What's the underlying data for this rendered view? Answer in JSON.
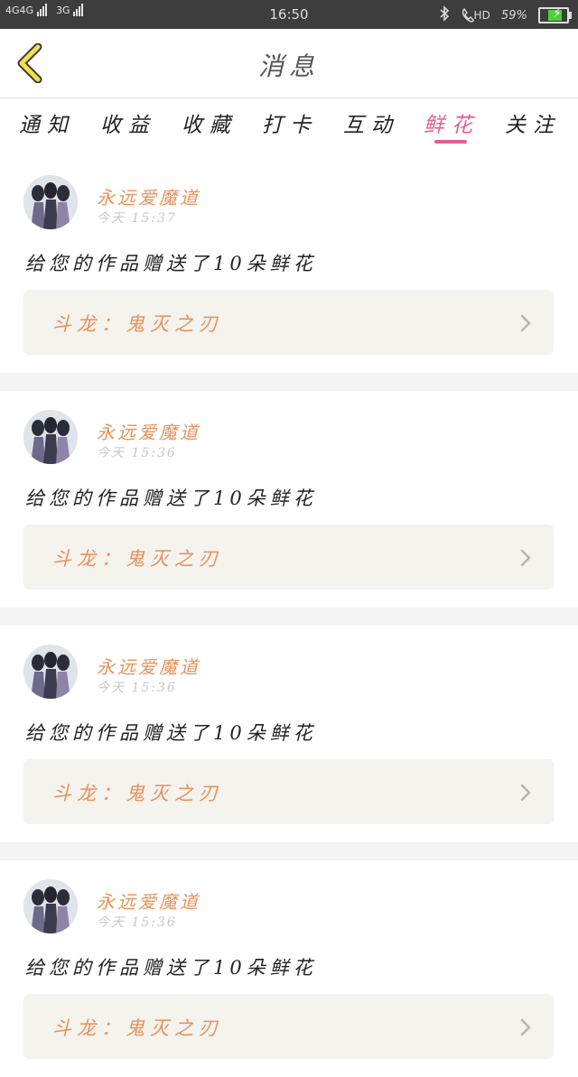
{
  "status_bar": {
    "network_1": "4G",
    "network_2": "4G",
    "network_3": "3G",
    "time": "16:50",
    "bluetooth_icon": "bluetooth-icon",
    "call_label": "HD",
    "battery_percent": "59%",
    "battery_level": 0.59,
    "charging_icon": "bolt-icon"
  },
  "header": {
    "title": "消息",
    "back_icon": "chevron-left-icon"
  },
  "tabs": [
    {
      "label": "通知",
      "active": false
    },
    {
      "label": "收益",
      "active": false
    },
    {
      "label": "收藏",
      "active": false
    },
    {
      "label": "打卡",
      "active": false
    },
    {
      "label": "互动",
      "active": false
    },
    {
      "label": "鲜花",
      "active": true
    },
    {
      "label": "关注",
      "active": false
    }
  ],
  "messages": [
    {
      "user": "永远爱魔道",
      "time": "今天 15:37",
      "text": "给您的作品赠送了10朵鲜花",
      "work": "斗龙：鬼灭之刃"
    },
    {
      "user": "永远爱魔道",
      "time": "今天 15:36",
      "text": "给您的作品赠送了10朵鲜花",
      "work": "斗龙：鬼灭之刃"
    },
    {
      "user": "永远爱魔道",
      "time": "今天 15:36",
      "text": "给您的作品赠送了10朵鲜花",
      "work": "斗龙：鬼灭之刃"
    },
    {
      "user": "永远爱魔道",
      "time": "今天 15:36",
      "text": "给您的作品赠送了10朵鲜花",
      "work": "斗龙：鬼灭之刃"
    }
  ],
  "colors": {
    "accent": "#e65d93",
    "orange": "#e8915a",
    "card_bg": "#f4f3ed",
    "back_yellow": "#f2e04a"
  }
}
